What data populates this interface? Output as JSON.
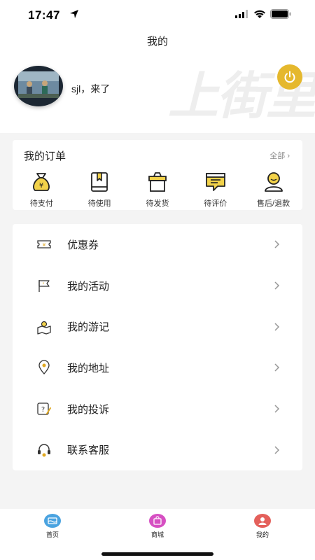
{
  "status_bar": {
    "time": "17:47"
  },
  "nav": {
    "title": "我的"
  },
  "header": {
    "username": "sjl，来了",
    "watermark": "上街里",
    "accent_color": "#e5b82d"
  },
  "orders": {
    "title": "我的订单",
    "view_all": "全部 ›",
    "items": [
      {
        "label": "待支付",
        "icon": "money-bag-icon"
      },
      {
        "label": "待使用",
        "icon": "book-icon"
      },
      {
        "label": "待发货",
        "icon": "package-icon"
      },
      {
        "label": "待评价",
        "icon": "comment-icon"
      },
      {
        "label": "售后/退款",
        "icon": "service-person-icon"
      }
    ]
  },
  "menu": {
    "items": [
      {
        "label": "优惠券",
        "icon": "coupon-icon"
      },
      {
        "label": "我的活动",
        "icon": "flag-icon"
      },
      {
        "label": "我的游记",
        "icon": "travel-note-icon"
      },
      {
        "label": "我的地址",
        "icon": "location-pin-icon"
      },
      {
        "label": "我的投诉",
        "icon": "complaint-icon"
      },
      {
        "label": "联系客服",
        "icon": "headset-icon"
      }
    ]
  },
  "tab_bar": {
    "items": [
      {
        "label": "首页",
        "icon": "home-icon",
        "color": "#4aa3e0"
      },
      {
        "label": "商城",
        "icon": "shop-icon",
        "color": "#d64fc2"
      },
      {
        "label": "我的",
        "icon": "user-icon",
        "color": "#e4605b"
      }
    ]
  }
}
